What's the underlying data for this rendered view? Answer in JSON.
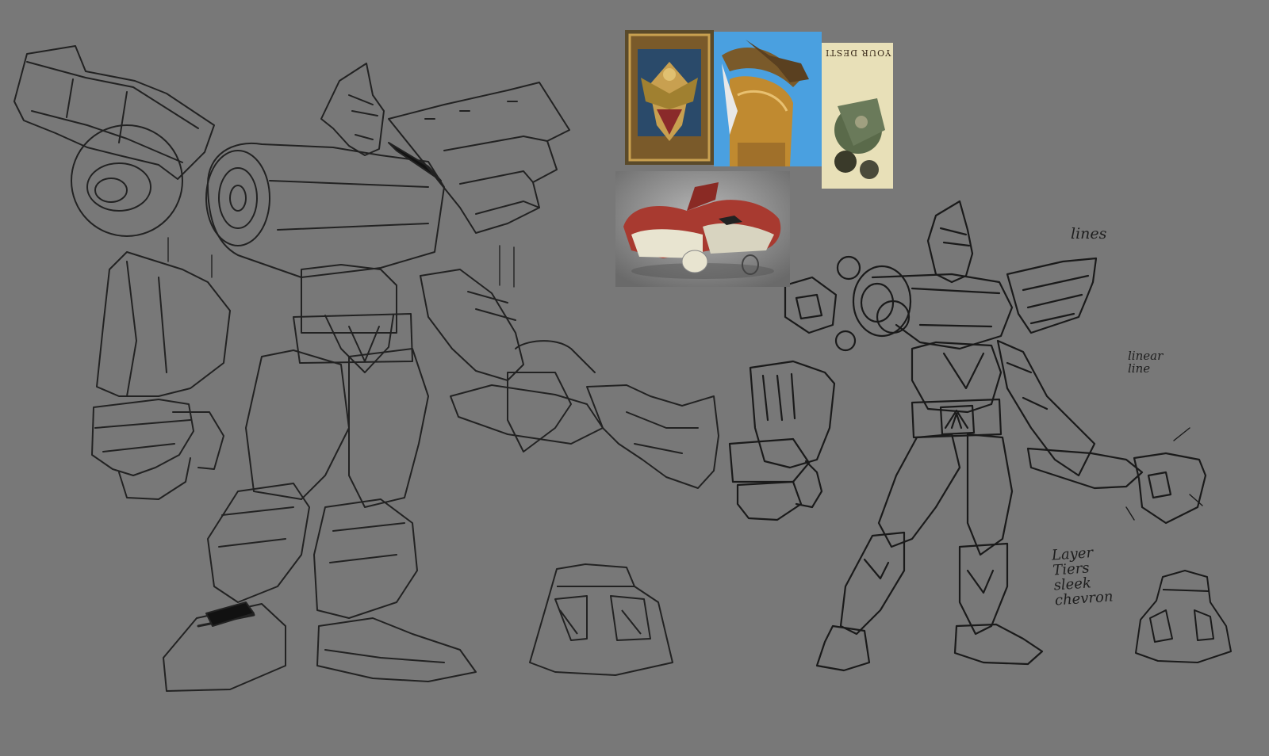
{
  "canvas": {
    "background": "#787878",
    "line_color": "#1e1e1e"
  },
  "annotations": {
    "lines": "lines",
    "linear_line": "linear\nline",
    "layer_notes": "Layer\nTiers\nsleek\nchevron"
  },
  "reference_board": {
    "poster_caption": "YOUR DESTI"
  }
}
